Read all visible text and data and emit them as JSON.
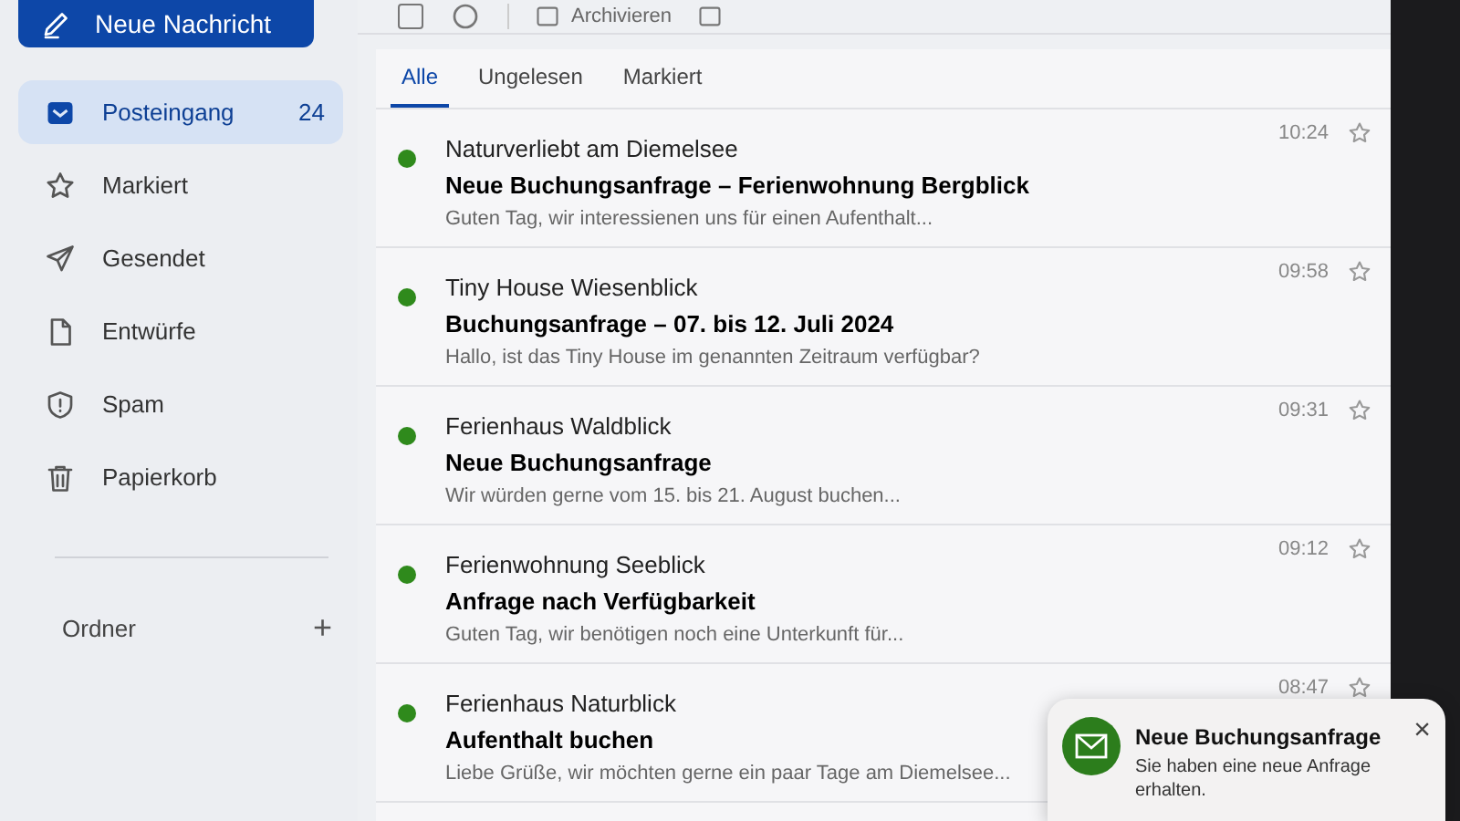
{
  "compose_button": {
    "label": "Neue Nachricht"
  },
  "sidebar": {
    "items": [
      {
        "kind": "inbox",
        "label": "Posteingang",
        "count": "24",
        "selected": true
      },
      {
        "kind": "star",
        "label": "Markiert",
        "selected": false
      },
      {
        "kind": "send",
        "label": "Gesendet",
        "selected": false
      },
      {
        "kind": "file",
        "label": "Entwürfe",
        "selected": false
      },
      {
        "kind": "shield",
        "label": "Spam",
        "selected": false
      },
      {
        "kind": "trash",
        "label": "Papierkorb",
        "selected": false
      }
    ],
    "folders": {
      "label": "Ordner",
      "add": "+"
    }
  },
  "toolbar": {
    "select_all": {
      "checked": false
    },
    "archive_label": "Archivieren"
  },
  "tabs": [
    {
      "label": "Alle",
      "selected": true
    },
    {
      "label": "Ungelesen",
      "selected": false
    },
    {
      "label": "Markiert",
      "selected": false
    }
  ],
  "messages": [
    {
      "sender": "Naturverliebt am Diemelsee",
      "subject": "Neue Buchungsanfrage – Ferienwohnung Bergblick",
      "preview": "Guten Tag, wir interessienen uns für einen Aufenthalt...",
      "time": "10:24",
      "unread": true,
      "starred": false
    },
    {
      "sender": "Tiny House Wiesenblick",
      "subject": "Buchungsanfrage – 07. bis 12. Juli 2024",
      "preview": "Hallo, ist das Tiny House im genannten Zeitraum verfügbar?",
      "time": "09:58",
      "unread": true,
      "starred": false
    },
    {
      "sender": "Ferienhaus Waldblick",
      "subject": "Neue Buchungsanfrage",
      "preview": "Wir würden gerne vom 15. bis 21. August buchen...",
      "time": "09:31",
      "unread": true,
      "starred": false
    },
    {
      "sender": "Ferienwohnung Seeblick",
      "subject": "Anfrage nach Verfügbarkeit",
      "preview": "Guten Tag, wir benötigen noch eine Unterkunft für...",
      "time": "09:12",
      "unread": true,
      "starred": false
    },
    {
      "sender": "Ferienhaus Naturblick",
      "subject": "Aufenthalt buchen",
      "preview": "Liebe Grüße, wir möchten gerne ein paar Tage am Diemelsee...",
      "time": "08:47",
      "unread": true,
      "starred": false
    }
  ],
  "toast": {
    "title": "Neue Buchungsanfrage",
    "message": "Sie haben eine neue Anfrage erhalten.",
    "close": "×"
  }
}
